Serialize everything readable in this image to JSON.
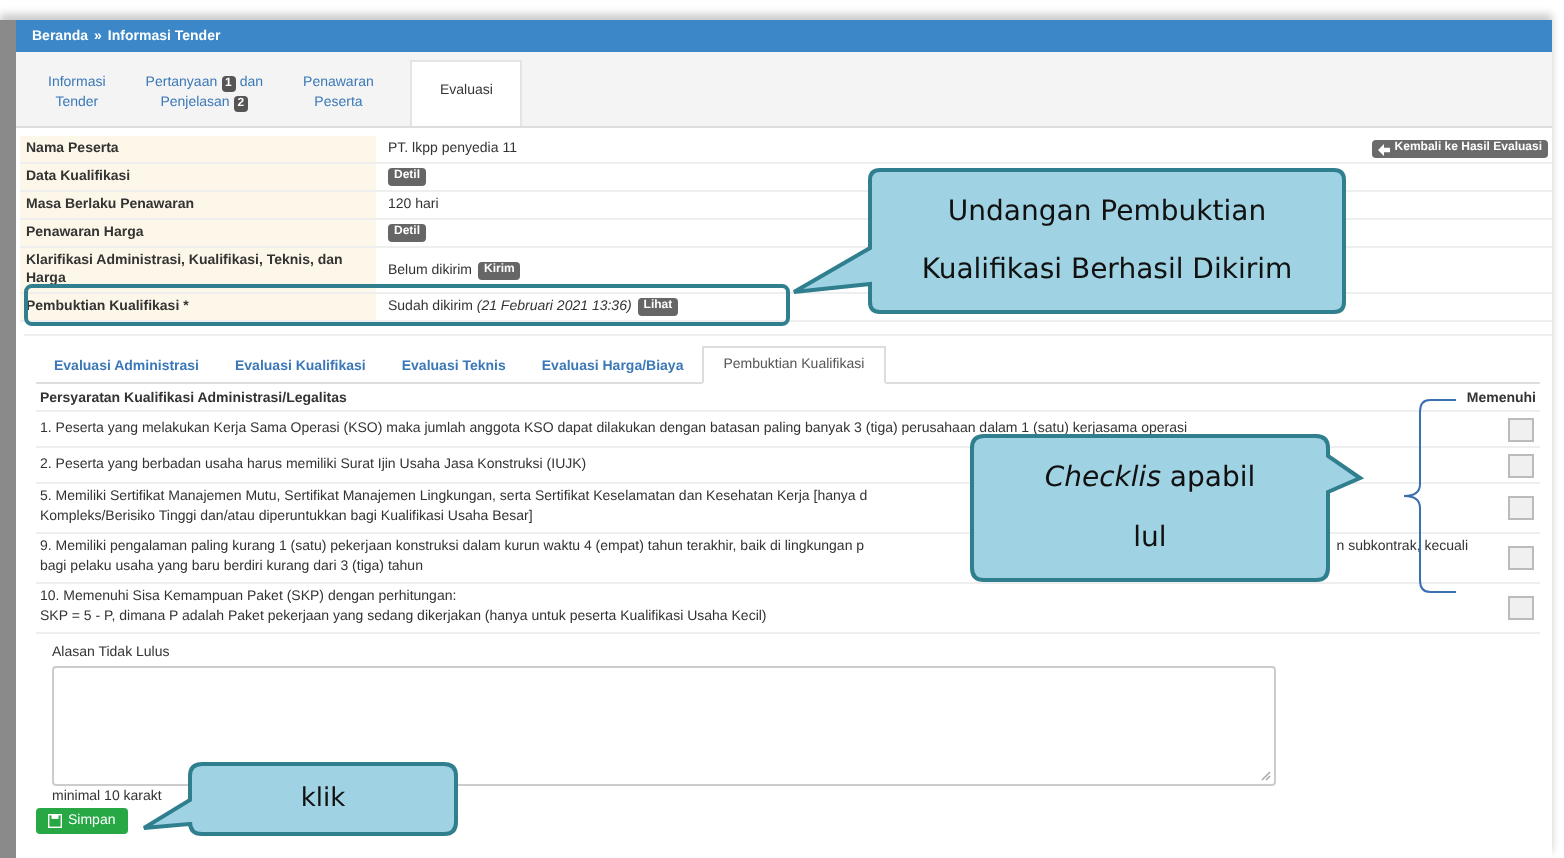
{
  "breadcrumb": {
    "items": [
      "Beranda",
      "Informasi Tender"
    ],
    "separator": "»"
  },
  "top_tabs": [
    {
      "parts": [
        {
          "kind": "text",
          "text": "Informasi"
        },
        {
          "kind": "break"
        },
        {
          "kind": "text",
          "text": "Tender"
        }
      ],
      "selected": false
    },
    {
      "parts": [
        {
          "kind": "text",
          "text": "Pertanyaan"
        },
        {
          "kind": "badge",
          "text": "1"
        },
        {
          "kind": "text",
          "text": "dan"
        },
        {
          "kind": "break"
        },
        {
          "kind": "text",
          "text": "Penjelasan"
        },
        {
          "kind": "badge",
          "text": "2"
        }
      ],
      "selected": false
    },
    {
      "parts": [
        {
          "kind": "text",
          "text": "Penawaran"
        },
        {
          "kind": "break"
        },
        {
          "kind": "text",
          "text": "Peserta"
        }
      ],
      "selected": false
    },
    {
      "parts": [
        {
          "kind": "text",
          "text": "Evaluasi"
        }
      ],
      "selected": true
    }
  ],
  "back_button": {
    "label": "Kembali ke Hasil Evaluasi"
  },
  "info_rows": [
    {
      "label": "Nama Peserta",
      "value": [
        {
          "kind": "text",
          "text": "PT. lkpp penyedia 11"
        }
      ]
    },
    {
      "label": "Data Kualifikasi",
      "value": [
        {
          "kind": "badge",
          "text": "Detil"
        }
      ]
    },
    {
      "label": "Masa Berlaku Penawaran",
      "value": [
        {
          "kind": "text",
          "text": "120 hari"
        }
      ]
    },
    {
      "label": "Penawaran Harga",
      "value": [
        {
          "kind": "badge",
          "text": "Detil"
        }
      ]
    },
    {
      "label": "Klarifikasi Administrasi, Kualifikasi, Teknis, dan Harga",
      "value": [
        {
          "kind": "text",
          "text": "Belum dikirim"
        },
        {
          "kind": "badge",
          "text": "Kirim"
        }
      ]
    },
    {
      "label": "Pembuktian Kualifikasi *",
      "value": [
        {
          "kind": "text",
          "text": "Sudah dikirim *(21 Februari 2021 13:36)*"
        },
        {
          "kind": "badge",
          "text": "Lihat"
        }
      ]
    }
  ],
  "inner_tabs": [
    {
      "label": "Evaluasi Administrasi",
      "selected": false
    },
    {
      "label": "Evaluasi Kualifikasi",
      "selected": false
    },
    {
      "label": "Evaluasi Teknis",
      "selected": false
    },
    {
      "label": "Evaluasi Harga/Biaya",
      "selected": false
    },
    {
      "label": "Pembuktian Kualifikasi",
      "selected": true
    }
  ],
  "requirements": {
    "heading": "Persyaratan Kualifikasi Administrasi/Legalitas",
    "column": "Memenuhi",
    "rows": [
      {
        "lines": [
          [
            "1. Peserta yang melakukan Kerja Sama Operasi (KSO) maka jumlah anggota KSO dapat dilakukan dengan batasan paling banyak 3 (tiga) perusahaan dalam 1 (satu) kerjasama operasi"
          ]
        ],
        "checked": false
      },
      {
        "lines": [
          [
            "2. Peserta yang berbadan usaha harus memiliki Surat Ijin Usaha Jasa Konstruksi (IUJK)"
          ]
        ],
        "checked": false
      },
      {
        "lines": [
          [
            "5. Memiliki Sertifikat Manajemen Mutu, Sertifikat Manajemen Lingkungan, serta Sertifikat Keselamatan dan Kesehatan Kerja [hanya d"
          ],
          [
            "Kompleks/Berisiko Tinggi dan/atau diperuntukkan bagi Kualifikasi Usaha Besar]"
          ]
        ],
        "checked": false
      },
      {
        "lines": [
          [
            "9. Memiliki pengalaman paling kurang 1 (satu) pekerjaan konstruksi dalam kurun waktu 4 (empat) tahun terakhir, baik di lingkungan p",
            "n subkontrak, kecuali"
          ],
          [
            "bagi pelaku usaha yang baru berdiri kurang dari 3 (tiga) tahun"
          ]
        ],
        "checked": false
      },
      {
        "lines": [
          [
            "10. Memenuhi Sisa Kemampuan Paket (SKP) dengan perhitungan:"
          ],
          [
            "SKP = 5 - P, dimana P adalah Paket pekerjaan yang sedang dikerjakan (hanya untuk peserta Kualifikasi Usaha Kecil)"
          ]
        ],
        "checked": false
      }
    ]
  },
  "reason": {
    "label": "Alasan Tidak Lulus",
    "hint": "minimal 10 karakt"
  },
  "save_button": {
    "label": "Simpan"
  },
  "callouts": [
    {
      "lines": [
        "Undangan Pembuktian",
        "Kualifikasi Berhasil Dikirim"
      ]
    },
    {
      "lines": [
        "*Checklis*  apabil",
        "lul"
      ]
    },
    {
      "lines": [
        "klik"
      ]
    }
  ]
}
